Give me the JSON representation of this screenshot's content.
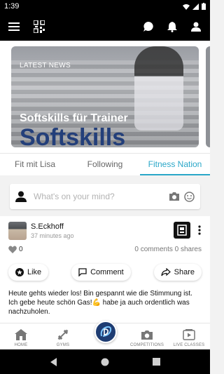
{
  "status": {
    "time": "1:39"
  },
  "news": {
    "tag": "LATEST NEWS",
    "title": "Softskills für Trainer",
    "image_word": "Softskills"
  },
  "tabs": [
    {
      "label": "Fit mit Lisa",
      "active": false
    },
    {
      "label": "Following",
      "active": false
    },
    {
      "label": "Fitness Nation",
      "active": true
    }
  ],
  "compose": {
    "placeholder": "What's on your mind?"
  },
  "post": {
    "author": "S.Eckhoff",
    "time": "37 minutes ago",
    "likes": "0",
    "stats": "0 comments 0 shares",
    "actions": {
      "like": "Like",
      "comment": "Comment",
      "share": "Share"
    },
    "text": "Heute gehts wieder los! Bin gespannt wie die Stimmung ist. Ich gebe heute schön Gas!💪 habe ja auch ordentlich was nachzuholen."
  },
  "nav": {
    "home": "HOME",
    "gyms": "GYMS",
    "competitions": "COMPETITIONS",
    "live_classes": "LIVE CLASSES"
  },
  "colors": {
    "accent": "#2aa7c8",
    "app_bar": "#000000",
    "brand": "#1e3c72"
  }
}
